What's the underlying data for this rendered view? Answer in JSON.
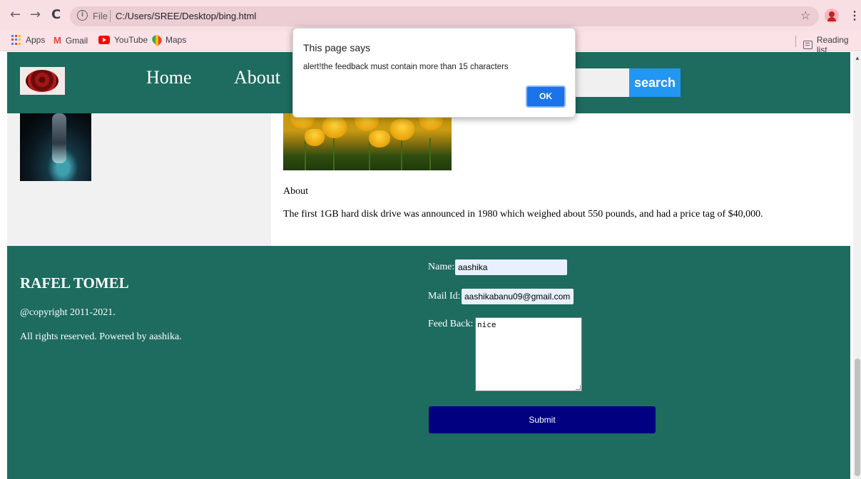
{
  "browser": {
    "back_icon": "←",
    "forward_icon": "→",
    "reload_icon": "C",
    "info_icon": "i",
    "file_label": "File",
    "url": "C:/Users/SREE/Desktop/bing.html",
    "star_icon": "☆",
    "kebab_icon": "⋮",
    "bookmarks": [
      "Apps",
      "Gmail",
      "YouTube",
      "Maps"
    ],
    "reading_list": "Reading list"
  },
  "site": {
    "nav": {
      "home": "Home",
      "about": "About"
    },
    "search_button": "search",
    "about_heading": "About",
    "fact": "The first 1GB hard disk drive was announced in 1980 which weighed about 550 pounds, and had a price tag of $40,000.",
    "footer": {
      "brand": "RAFEL TOMEL",
      "copyright": "@copyright 2011-2021.",
      "rights": "All rights reserved. Powered by aashika."
    },
    "form": {
      "name_label": "Name:",
      "name_value": "aashika",
      "mail_label": "Mail Id:",
      "mail_value": "aashikabanu09@gmail.com",
      "feedback_label": "Feed Back:",
      "feedback_value": "nice",
      "submit_label": "Submit"
    },
    "colors": {
      "theme": "#1e6b5f",
      "search_button": "#2196f3",
      "submit_button": "#000080"
    }
  },
  "dialog": {
    "title": "This page says",
    "message": "alert!the feedback must contain more than 15 characters",
    "ok_label": "OK"
  }
}
